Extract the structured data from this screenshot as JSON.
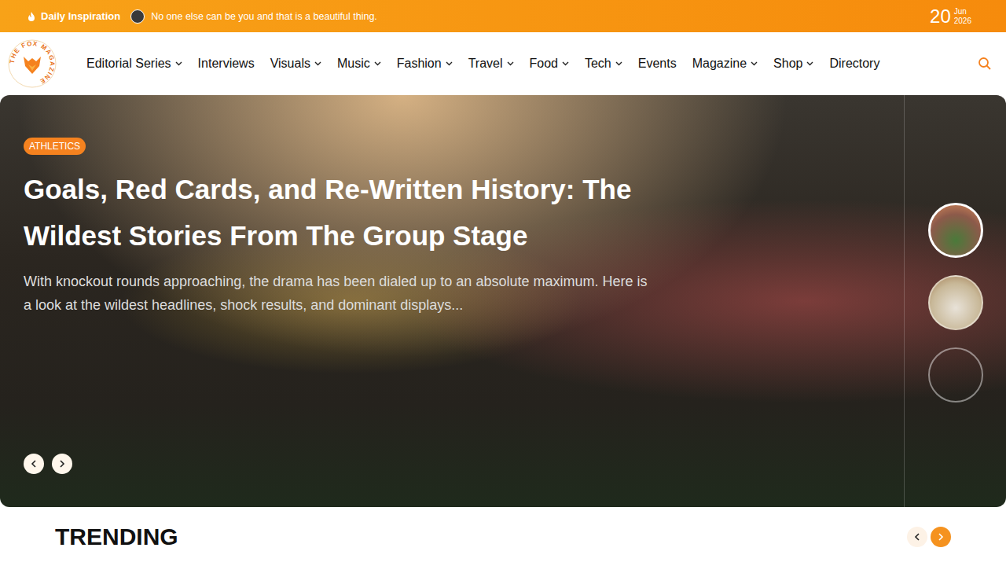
{
  "topbar": {
    "label": "Daily Inspiration",
    "quote": "No one else can be you and that is a beautiful thing.",
    "date": {
      "day": "20",
      "month": "Jun",
      "year": "2026"
    }
  },
  "logo": {
    "text": "THE FOX MAGAZINE"
  },
  "nav": [
    {
      "label": "Editorial Series",
      "dropdown": true
    },
    {
      "label": "Interviews",
      "dropdown": false
    },
    {
      "label": "Visuals",
      "dropdown": true
    },
    {
      "label": "Music",
      "dropdown": true
    },
    {
      "label": "Fashion",
      "dropdown": true
    },
    {
      "label": "Travel",
      "dropdown": true
    },
    {
      "label": "Food",
      "dropdown": true
    },
    {
      "label": "Tech",
      "dropdown": true
    },
    {
      "label": "Events",
      "dropdown": false
    },
    {
      "label": "Magazine",
      "dropdown": true
    },
    {
      "label": "Shop",
      "dropdown": true
    },
    {
      "label": "Directory",
      "dropdown": false
    }
  ],
  "hero": {
    "tag": "ATHLETICS",
    "title": "Goals, Red Cards, and Re-Written History: The Wildest Stories From The Group Stage",
    "excerpt": "With knockout rounds approaching, the drama has been dialed up to an absolute maximum. Here is a look at the wildest headlines, shock results, and dominant displays...",
    "controls": [
      {
        "kind": "prev"
      },
      {
        "kind": "next"
      }
    ]
  },
  "slides": [
    {
      "kind": "image",
      "selected": true
    },
    {
      "kind": "image",
      "selected": false
    },
    {
      "kind": "placeholder",
      "selected": false
    }
  ],
  "trending": {
    "title": "TRENDING",
    "controls": [
      {
        "kind": "prev",
        "active": false
      },
      {
        "kind": "next",
        "active": true
      }
    ]
  }
}
